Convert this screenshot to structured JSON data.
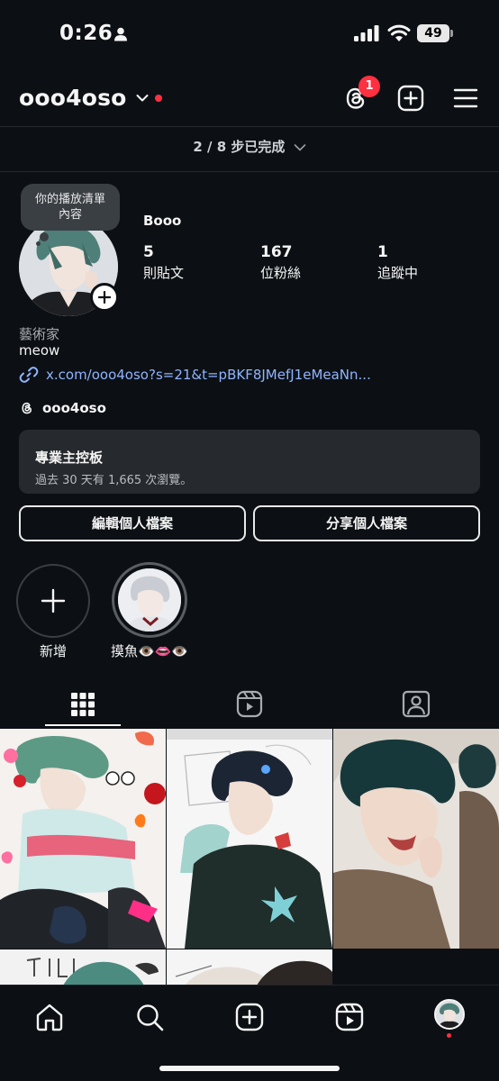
{
  "status_bar": {
    "time": "0:26",
    "battery": "49"
  },
  "header": {
    "username": "ooo4oso",
    "threads_badge": "1"
  },
  "progress": {
    "text": "2 / 8 步已完成"
  },
  "profile": {
    "note": "你的播放清單\n內容",
    "display_name": "Booo",
    "stats": [
      {
        "count": "5",
        "label": "則貼文"
      },
      {
        "count": "167",
        "label": "位粉絲"
      },
      {
        "count": "1",
        "label": "追蹤中"
      }
    ],
    "category": "藝術家",
    "bio": "meow",
    "link": "x.com/ooo4oso?s=21&t=pBKF8JMefJ1eMeaNn...",
    "threads_handle": "ooo4oso"
  },
  "dashboard": {
    "title": "專業主控板",
    "subtitle": "過去 30 天有 1,665 次瀏覽。"
  },
  "buttons": {
    "edit": "編輯個人檔案",
    "share": "分享個人檔案"
  },
  "highlights": [
    {
      "label": "新增"
    },
    {
      "label": "摸魚👁️👄👁️"
    }
  ],
  "tabs": [
    "posts-grid",
    "reels",
    "tagged"
  ],
  "icons": [
    "person-icon",
    "signal-icon",
    "wifi-icon",
    "threads-icon",
    "create-icon",
    "menu-icon",
    "chevron-down-icon",
    "link-icon",
    "grid-icon",
    "reels-icon",
    "tagged-icon",
    "home-icon",
    "search-icon"
  ],
  "colors": {
    "background": "#0c1014",
    "accent_red": "#ff3040",
    "link": "#8fb4ff",
    "card": "#26292d"
  }
}
